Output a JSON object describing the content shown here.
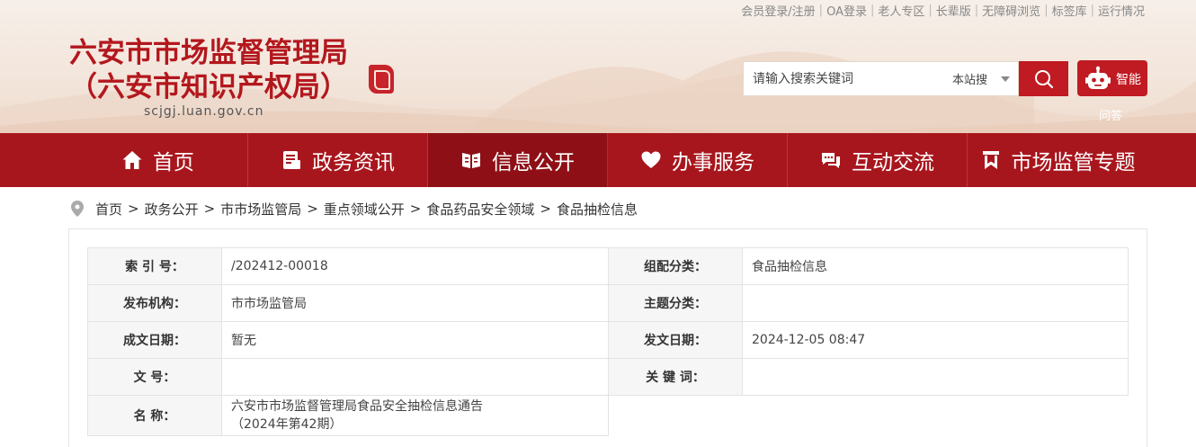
{
  "header": {
    "top_links": [
      "会员登录/注册",
      "OA登录",
      "老人专区",
      "长辈版",
      "无障碍浏览",
      "标签库",
      "运行情况"
    ],
    "site_name_line1": "六安市市场监督管理局",
    "site_name_line2": "（六安市知识产权局）",
    "domain": "scjgj.luan.gov.cn",
    "search_placeholder": "请输入搜索关键词",
    "search_scope": "本站搜",
    "ai_label": "智能",
    "ai_sub": "问答",
    "brand_color": "#b3171d"
  },
  "nav": {
    "items": [
      {
        "label": "首页",
        "icon": "home-icon"
      },
      {
        "label": "政务资讯",
        "icon": "document-icon"
      },
      {
        "label": "信息公开",
        "icon": "open-book-icon"
      },
      {
        "label": "办事服务",
        "icon": "heart-icon"
      },
      {
        "label": "互动交流",
        "icon": "chat-icon"
      },
      {
        "label": "市场监管专题",
        "icon": "bookmark-icon"
      }
    ],
    "active_index": 2
  },
  "breadcrumb": [
    "首页",
    "政务公开",
    "市市场监管局",
    "重点领域公开",
    "食品药品安全领域",
    "食品抽检信息"
  ],
  "info": {
    "index_label": "索 引 号：",
    "index_value": "/202412-00018",
    "category_label": "组配分类：",
    "category_value": "食品抽检信息",
    "publisher_label": "发布机构：",
    "publisher_value": "市市场监管局",
    "topic_label": "主题分类：",
    "topic_value": "",
    "created_label": "成文日期：",
    "created_value": "暂无",
    "published_label": "发文日期：",
    "published_value": "2024-12-05 08:47",
    "docno_label": "文 号：",
    "docno_value": "",
    "keywords_label": "关 键 词：",
    "keywords_value": "",
    "name_label": "名 称：",
    "name_value_line1": "六安市市场监督管理局食品安全抽检信息通告",
    "name_value_line2": "（2024年第42期）"
  }
}
